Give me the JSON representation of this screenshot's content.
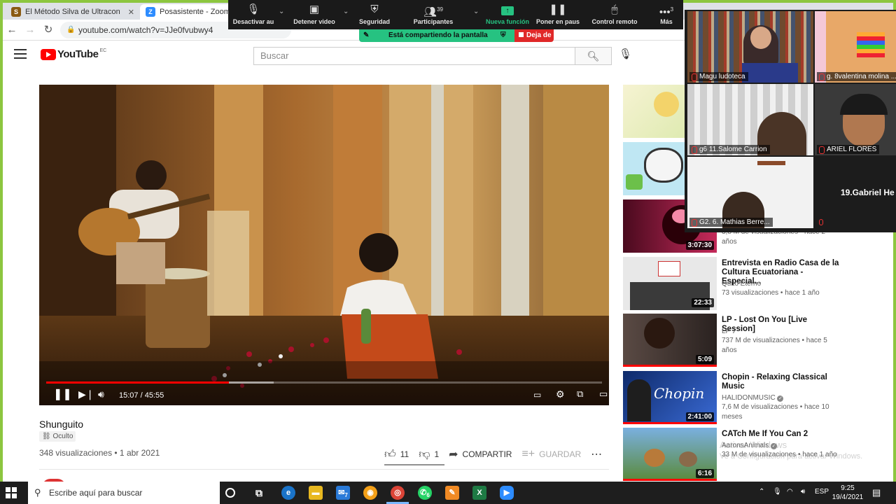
{
  "browser": {
    "tabs": [
      {
        "label": "El Método Silva de Ultracontrol M",
        "favicon": "S"
      },
      {
        "label": "Posasistente - Zoom",
        "favicon": "Z"
      }
    ],
    "url": "youtube.com/watch?v=JJe0fvubwy4"
  },
  "youtube": {
    "logo_text": "YouTube",
    "region": "EC",
    "search_placeholder": "Buscar",
    "video": {
      "time": "15:07 / 45:55",
      "progress": 0.329,
      "title": "Shunguito",
      "visibility": "Oculto",
      "views_date": "348 visualizaciones • 1 abr 2021",
      "likes": "11",
      "dislikes": "1",
      "share_label": "COMPARTIR",
      "save_label": "GUARDAR"
    },
    "recommendations": [
      {
        "title": "",
        "channel": "",
        "meta": "",
        "duration": "",
        "watched": 0,
        "thumb": "angel"
      },
      {
        "title": "",
        "channel": "",
        "meta": "",
        "duration": "",
        "watched": 0,
        "thumb": "cartoon"
      },
      {
        "title": "",
        "channel": "",
        "meta": "3,8 M de visualizaciones • hace 2 años",
        "duration": "3:07:30",
        "watched": 0,
        "thumb": "brain"
      },
      {
        "title": "Entrevista en Radio Casa de la Cultura Ecuatoriana - Especial...",
        "channel": "Quito Eterno",
        "meta": "73 visualizaciones • hace 1 año",
        "duration": "22:33",
        "watched": 0,
        "thumb": "radio"
      },
      {
        "title": "LP - Lost On You [Live Session]",
        "channel": "LP ♪",
        "meta": "737 M de visualizaciones • hace 5 años",
        "duration": "5:09",
        "watched": 1,
        "thumb": "lp"
      },
      {
        "title": "Chopin - Relaxing Classical Music",
        "channel": "HALIDONMUSIC",
        "meta": "7,6 M de visualizaciones • hace 10 meses",
        "duration": "2:41:00",
        "watched": 1,
        "thumb": "chopin"
      },
      {
        "title": "CATch Me If You Can 2",
        "channel": "AaronsAnimals",
        "meta": "33 M de visualizaciones • hace 1 año",
        "duration": "6:16",
        "watched": 1,
        "thumb": "cats"
      }
    ],
    "chopin_thumb_text": "Chopin"
  },
  "zoom": {
    "toolbar": [
      {
        "label": "Desactivar au",
        "icon": "microphone-icon"
      },
      {
        "label": "Detener video",
        "icon": "camera-icon"
      },
      {
        "label": "Seguridad",
        "icon": "shield-icon"
      },
      {
        "label": "Participantes",
        "icon": "participants-icon",
        "count": "39"
      },
      {
        "label": "Nueva función",
        "icon": "share-screen-icon"
      },
      {
        "label": "Poner en paus",
        "icon": "pause-icon"
      },
      {
        "label": "Control remoto",
        "icon": "mouse-icon"
      },
      {
        "label": "Más",
        "icon": "more-icon",
        "count": "3"
      }
    ],
    "share_status": "Está compartiendo la pantalla",
    "stop_share": "Deja de",
    "participants": [
      {
        "name": "Magu ludoteca"
      },
      {
        "name": "g. 8valentina molina ..."
      },
      {
        "name": "g6 11.Salome Carrion"
      },
      {
        "name": "ARIEL FLORES"
      },
      {
        "name": "G2. 6. Mathias Berre..."
      }
    ],
    "name_only_participant": "19.Gabriel  He"
  },
  "watermark": {
    "line1": "Activar Windows",
    "line2": "Ve a Configuración para activar Windows."
  },
  "taskbar": {
    "search_placeholder": "Escribe aquí para buscar",
    "mail_badge": "7",
    "whatsapp_badge": "6",
    "lang": "ESP",
    "time": "9:25",
    "date": "19/4/2021"
  }
}
